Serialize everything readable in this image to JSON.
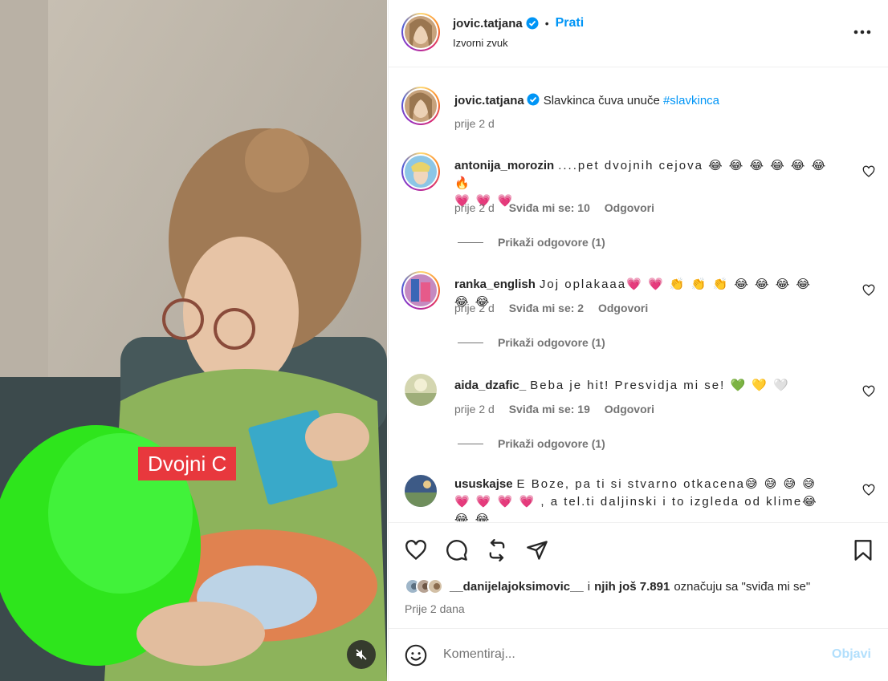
{
  "post": {
    "author": "jovic.tatjana",
    "follow_label": "Prati",
    "audio": "Izvorni zvuk",
    "more_icon": "more-horizontal-icon"
  },
  "media": {
    "overlay_label": "Dvojni C",
    "mute_icon": "volume-muted-icon"
  },
  "caption": {
    "user": "jovic.tatjana",
    "text": "Slavkinca čuva unuče",
    "hashtag": "#slavkinca",
    "time": "prije 2 d"
  },
  "comments": [
    {
      "user": "antonija_morozin",
      "text": "....pet dvojnih cejova 😂 😂 😂 😂 😂 😂 🔥",
      "text2": "💗 💗 💗",
      "time": "prije 2 d",
      "likes": "Sviđa mi se: 10",
      "reply": "Odgovori",
      "view_replies": "Prikaži odgovore (1)"
    },
    {
      "user": "ranka_english",
      "text": "Joj oplakaaa💗 💗 👏 👏 👏 😂 😂 😂 😂 😂 😂",
      "time": "prije 2 d",
      "likes": "Sviđa mi se: 2",
      "reply": "Odgovori",
      "view_replies": "Prikaži odgovore (1)"
    },
    {
      "user": "aida_dzafic_",
      "text": "Beba je hit! Presvidja mi se! 💚 💛 🤍",
      "time": "prije 2 d",
      "likes": "Sviđa mi se: 19",
      "reply": "Odgovori",
      "view_replies": "Prikaži odgovore (1)"
    },
    {
      "user": "ususkajse",
      "text": "E Boze, pa ti si stvarno otkacena😅 😅 😅 😅",
      "text2": "💗 💗 💗 💗 , a tel.ti daljinski i to izgleda od klime😂 😂 😂"
    }
  ],
  "actions": {
    "like_icon": "heart-icon",
    "comment_icon": "comment-icon",
    "share_icon": "repost-icon",
    "send_icon": "send-icon",
    "save_icon": "bookmark-icon"
  },
  "likes": {
    "user": "__danijelajoksimovic__",
    "connector": "i",
    "others": "njih još 7.891",
    "suffix": "označuju sa \"sviđa mi se\"",
    "date": "Prije 2 dana"
  },
  "composer": {
    "placeholder": "Komentiraj...",
    "post_label": "Objavi",
    "emoji_icon": "smiley-icon"
  },
  "colors": {
    "accent": "#0095f6",
    "label_bg": "#e8383d",
    "muted_text": "#737373"
  }
}
